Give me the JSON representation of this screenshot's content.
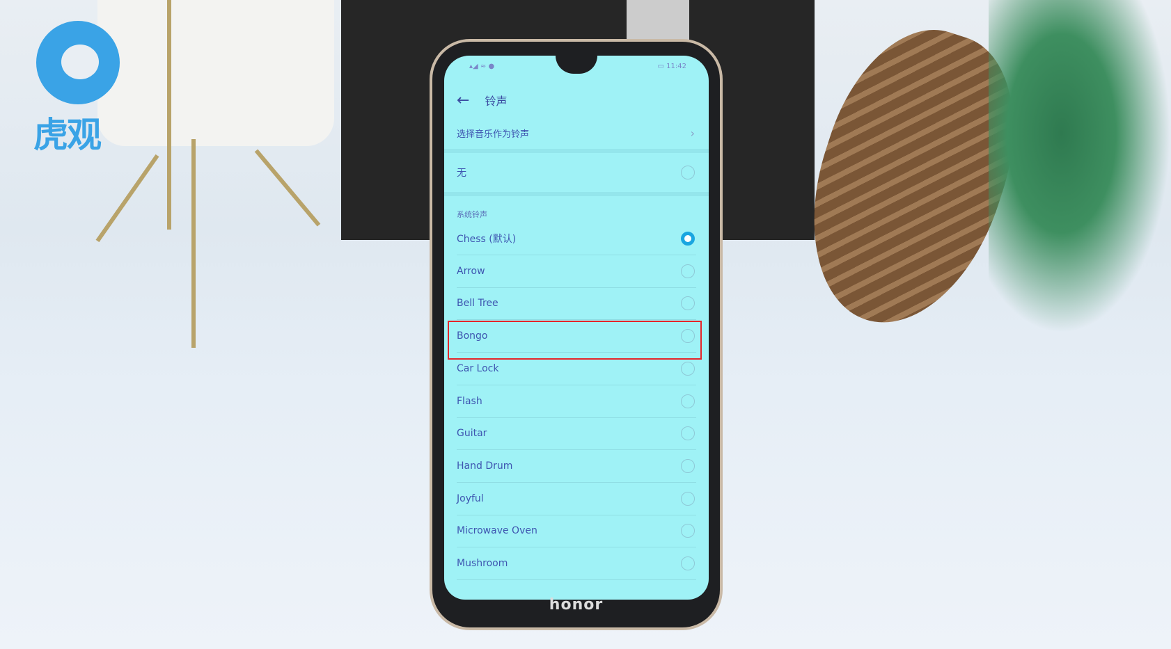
{
  "watermark": {
    "text": "虎观",
    "color": "#3aa3e6"
  },
  "status_bar": {
    "time": "11:42"
  },
  "header": {
    "back_icon": "arrow-left",
    "title": "铃声"
  },
  "choose_music": {
    "label": "选择音乐作为铃声"
  },
  "none_option": {
    "label": "无",
    "selected": false
  },
  "section_title": "系统铃声",
  "ringtones": [
    {
      "label": "Chess (默认)",
      "selected": true
    },
    {
      "label": "Arrow",
      "selected": false
    },
    {
      "label": "Bell Tree",
      "selected": false
    },
    {
      "label": "Bongo",
      "selected": false,
      "highlighted": true
    },
    {
      "label": "Car Lock",
      "selected": false
    },
    {
      "label": "Flash",
      "selected": false
    },
    {
      "label": "Guitar",
      "selected": false
    },
    {
      "label": "Hand Drum",
      "selected": false
    },
    {
      "label": "Joyful",
      "selected": false
    },
    {
      "label": "Microwave Oven",
      "selected": false
    },
    {
      "label": "Mushroom",
      "selected": false
    }
  ],
  "phone_brand": "honor",
  "colors": {
    "accent": "#1aa6e0",
    "highlight_box": "#e5262a",
    "screen_bg": "#9ff2f6"
  }
}
